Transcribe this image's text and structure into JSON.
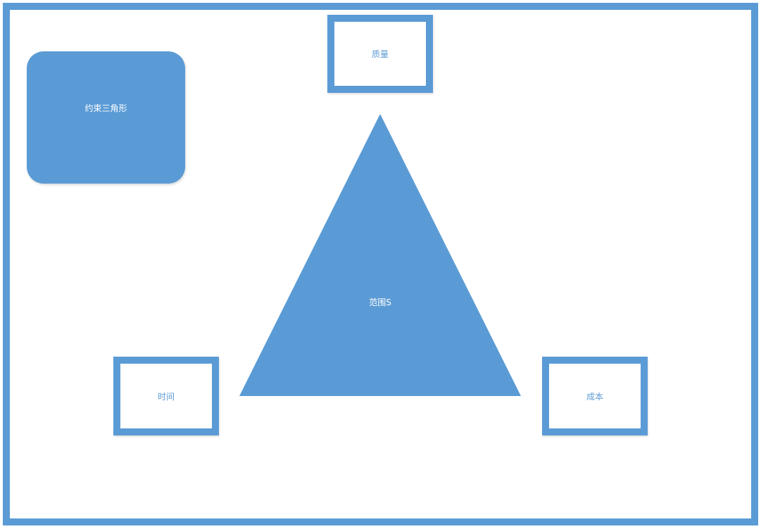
{
  "diagram": {
    "title": "约束三角形",
    "center_label": "范围S",
    "top_label": "质量",
    "left_label": "时间",
    "right_label": "成本"
  },
  "colors": {
    "accent": "#5b9bd5",
    "background": "#ffffff",
    "text_on_accent": "#ffffff"
  }
}
